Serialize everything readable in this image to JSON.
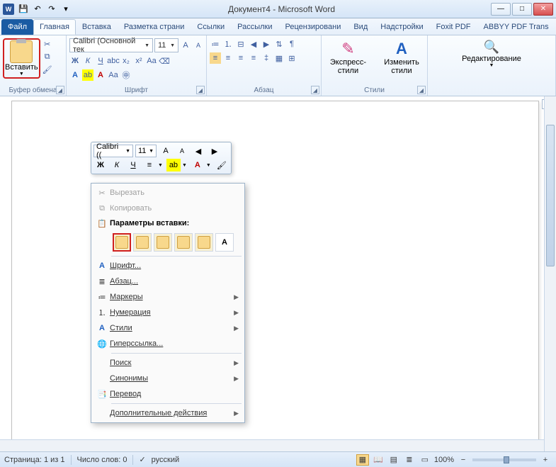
{
  "title": "Документ4 - Microsoft Word",
  "tabs": {
    "file": "Файл",
    "home": "Главная",
    "insert": "Вставка",
    "layout": "Разметка страни",
    "refs": "Ссылки",
    "mail": "Рассылки",
    "review": "Рецензировани",
    "view": "Вид",
    "addins": "Надстройки",
    "foxit": "Foxit PDF",
    "abbyy": "ABBYY PDF Trans"
  },
  "ribbon": {
    "paste": "Вставить",
    "clipboard": "Буфер обмена",
    "font_name": "Calibri (Основной тек",
    "font_size": "11",
    "font": "Шрифт",
    "paragraph": "Абзац",
    "quickstyles": "Экспресс-стили",
    "changestyles": "Изменить стили",
    "styles": "Стили",
    "editing": "Редактирование"
  },
  "mini": {
    "font": "Calibri ((",
    "size": "11",
    "bold": "Ж",
    "italic": "К",
    "under": "Ч"
  },
  "ctx": {
    "cut": "Вырезать",
    "copy": "Копировать",
    "pasteopts": "Параметры вставки:",
    "font": "Шрифт...",
    "para": "Абзац...",
    "bullets": "Маркеры",
    "numbering": "Нумерация",
    "styles": "Стили",
    "hyperlink": "Гиперссылка...",
    "search": "Поиск",
    "synonyms": "Синонимы",
    "translate": "Перевод",
    "additional": "Дополнительные действия"
  },
  "status": {
    "page": "Страница: 1 из 1",
    "words": "Число слов: 0",
    "lang": "русский",
    "zoom": "100%"
  }
}
